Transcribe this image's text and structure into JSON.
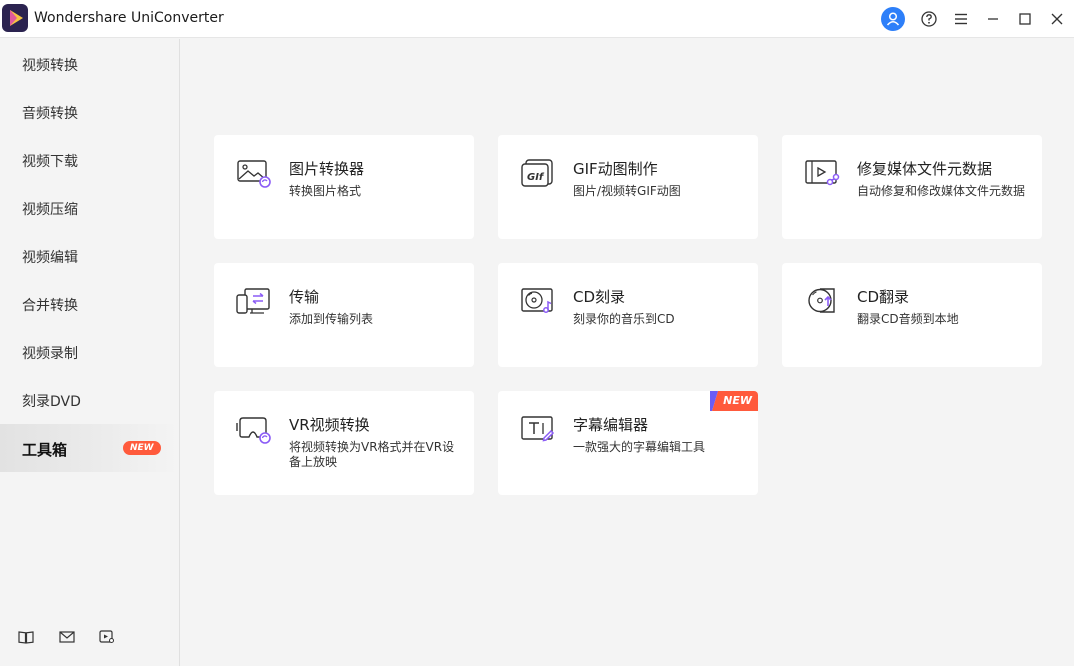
{
  "app": {
    "title": "Wondershare UniConverter"
  },
  "colors": {
    "accent": "#8b5cf6",
    "account": "#2d7ff9",
    "badge": "#ff5a3c"
  },
  "sidebar": {
    "items": [
      {
        "label": "视频转换"
      },
      {
        "label": "音频转换"
      },
      {
        "label": "视频下载"
      },
      {
        "label": "视频压缩"
      },
      {
        "label": "视频编辑"
      },
      {
        "label": "合并转换"
      },
      {
        "label": "视频录制"
      },
      {
        "label": "刻录DVD"
      },
      {
        "label": "工具箱",
        "badge": "NEW",
        "active": true
      }
    ],
    "bottom_icons": [
      "book-icon",
      "mail-icon",
      "feedback-icon"
    ]
  },
  "tools": [
    {
      "title": "图片转换器",
      "desc": "转换图片格式",
      "icon": "image-convert-icon"
    },
    {
      "title": "GIF动图制作",
      "desc": "图片/视频转GIF动图",
      "icon": "gif-icon"
    },
    {
      "title": "修复媒体文件元数据",
      "desc": "自动修复和修改媒体文件元数据",
      "icon": "metadata-icon"
    },
    {
      "title": "传输",
      "desc": "添加到传输列表",
      "icon": "transfer-icon"
    },
    {
      "title": "CD刻录",
      "desc": "刻录你的音乐到CD",
      "icon": "cd-burn-icon"
    },
    {
      "title": "CD翻录",
      "desc": "翻录CD音频到本地",
      "icon": "cd-rip-icon"
    },
    {
      "title": "VR视频转换",
      "desc": "将视频转换为VR格式并在VR设备上放映",
      "icon": "vr-icon"
    },
    {
      "title": "字幕编辑器",
      "desc": "一款强大的字幕编辑工具",
      "icon": "subtitle-icon",
      "badge": "NEW"
    }
  ]
}
